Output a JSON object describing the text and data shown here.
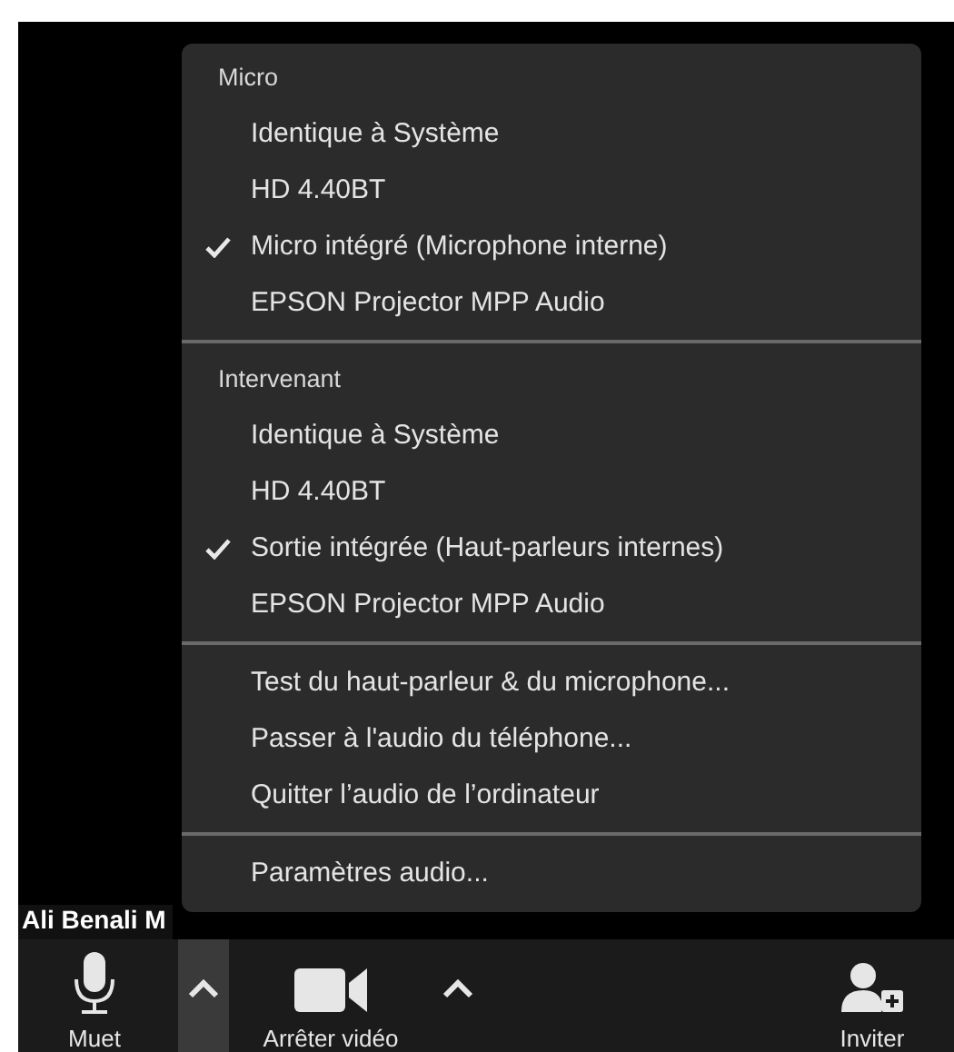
{
  "menu": {
    "sections": [
      {
        "title": "Micro",
        "items": [
          {
            "label": "Identique à Système",
            "checked": false
          },
          {
            "label": "HD 4.40BT",
            "checked": false
          },
          {
            "label": "Micro intégré (Microphone interne)",
            "checked": true
          },
          {
            "label": "EPSON Projector MPP Audio",
            "checked": false
          }
        ]
      },
      {
        "title": "Intervenant",
        "items": [
          {
            "label": "Identique à Système",
            "checked": false
          },
          {
            "label": "HD 4.40BT",
            "checked": false
          },
          {
            "label": "Sortie intégrée (Haut-parleurs internes)",
            "checked": true
          },
          {
            "label": "EPSON Projector MPP Audio",
            "checked": false
          }
        ]
      },
      {
        "items": [
          {
            "label": "Test du haut-parleur & du microphone...",
            "checked": false
          },
          {
            "label": "Passer à l'audio du téléphone...",
            "checked": false
          },
          {
            "label": "Quitter l’audio de l’ordinateur",
            "checked": false
          }
        ]
      },
      {
        "items": [
          {
            "label": "Paramètres audio...",
            "checked": false
          }
        ]
      }
    ]
  },
  "participant_name": "Ali Benali M",
  "toolbar": [
    {
      "kind": "mute",
      "label": "Muet"
    },
    {
      "kind": "caret",
      "expanded": true
    },
    {
      "kind": "video",
      "label": "Arrêter vidéo"
    },
    {
      "kind": "caret",
      "expanded": false
    },
    {
      "kind": "invite",
      "label": "Inviter"
    }
  ]
}
